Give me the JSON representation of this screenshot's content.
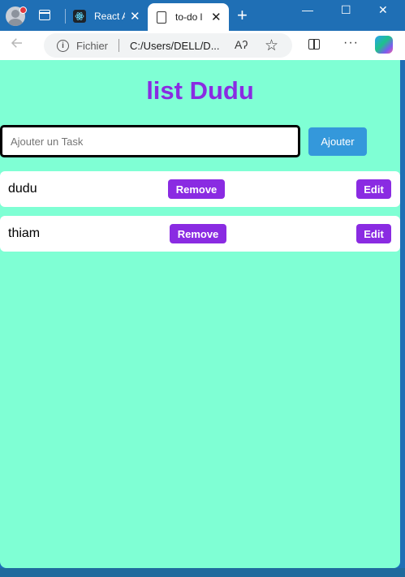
{
  "browser": {
    "tabs": [
      {
        "label": "React A",
        "active": false
      },
      {
        "label": "to-do l",
        "active": true
      }
    ],
    "new_tab": "+",
    "close_glyph": "✕",
    "window_controls": {
      "minimize": "—",
      "maximize": "☐",
      "close": "✕"
    },
    "address": {
      "scheme_label": "Fichier",
      "url": "C:/Users/DELL/D...",
      "read_aloud": "Aʔ"
    }
  },
  "app": {
    "title": "list Dudu",
    "input": {
      "value": "",
      "placeholder": "Ajouter un Task"
    },
    "add_label": "Ajouter",
    "tasks": [
      {
        "name": "dudu",
        "remove_label": "Remove",
        "edit_label": "Edit"
      },
      {
        "name": "thiam",
        "remove_label": "Remove",
        "edit_label": "Edit"
      }
    ]
  },
  "colors": {
    "page_bg": "#7fffd4",
    "title": "#8a2be2",
    "add_button": "#3498db",
    "task_buttons": "#8a2be2",
    "titlebar": "#1f6fb5"
  }
}
